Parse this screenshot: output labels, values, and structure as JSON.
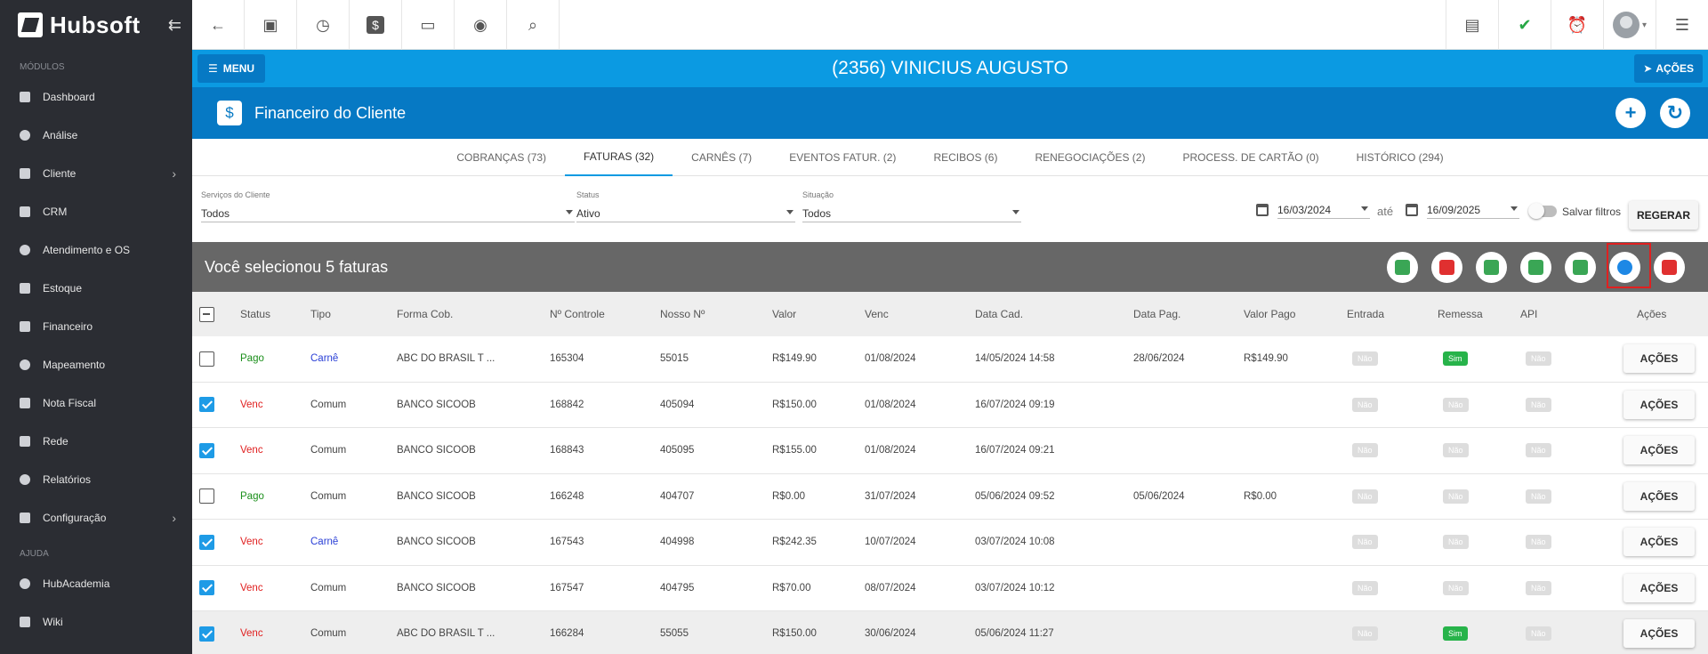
{
  "sidebar": {
    "brand": "Hubsoft",
    "collapse_icon": "arrow-collapse-icon",
    "section_modules": "MÓDULOS",
    "section_help": "AJUDA",
    "items": [
      {
        "label": "Dashboard",
        "icon": "grid-icon",
        "chevron": ""
      },
      {
        "label": "Análise",
        "icon": "pie-chart-icon",
        "chevron": ""
      },
      {
        "label": "Cliente",
        "icon": "contact-card-icon",
        "chevron": "›"
      },
      {
        "label": "CRM",
        "icon": "crm-icon",
        "chevron": ""
      },
      {
        "label": "Atendimento e OS",
        "icon": "calendar-clock-icon",
        "chevron": ""
      },
      {
        "label": "Estoque",
        "icon": "box-icon",
        "chevron": ""
      },
      {
        "label": "Financeiro",
        "icon": "money-icon",
        "chevron": ""
      },
      {
        "label": "Mapeamento",
        "icon": "map-pin-icon",
        "chevron": ""
      },
      {
        "label": "Nota Fiscal",
        "icon": "receipt-icon",
        "chevron": ""
      },
      {
        "label": "Rede",
        "icon": "network-icon",
        "chevron": ""
      },
      {
        "label": "Relatórios",
        "icon": "report-icon",
        "chevron": ""
      },
      {
        "label": "Configuração",
        "icon": "gear-icon",
        "chevron": "›"
      }
    ],
    "help_items": [
      {
        "label": "HubAcademia",
        "icon": "play-icon"
      },
      {
        "label": "Wiki",
        "icon": "wiki-icon"
      }
    ]
  },
  "topbar": {
    "left_icons": [
      "back-arrow-icon",
      "contact-icon",
      "calendar-clock-icon",
      "dollar-icon",
      "terminal-icon",
      "eye-icon",
      "search-icon"
    ],
    "right_icons": [
      "pdf-icon",
      "chat-check-icon",
      "alarm-bell-icon",
      "user-avatar-icon",
      "list-menu-icon"
    ]
  },
  "clientbar": {
    "menu_label": "MENU",
    "client_name": "(2356) VINICIUS AUGUSTO",
    "actions_label": "AÇÕES"
  },
  "section": {
    "title": "Financeiro do Cliente",
    "icon_glyph": "$"
  },
  "tabs": [
    {
      "label": "COBRANÇAS (73)",
      "active": false
    },
    {
      "label": "FATURAS (32)",
      "active": true
    },
    {
      "label": "CARNÊS (7)",
      "active": false
    },
    {
      "label": "EVENTOS FATUR. (2)",
      "active": false
    },
    {
      "label": "RECIBOS (6)",
      "active": false
    },
    {
      "label": "RENEGOCIAÇÕES (2)",
      "active": false
    },
    {
      "label": "PROCESS. DE CARTÃO (0)",
      "active": false
    },
    {
      "label": "HISTÓRICO (294)",
      "active": false
    }
  ],
  "filters": {
    "servicos_label": "Serviços do Cliente",
    "servicos_value": "Todos",
    "status_label": "Status",
    "status_value": "Ativo",
    "situacao_label": "Situação",
    "situacao_value": "Todos",
    "date_from": "16/03/2024",
    "ate": "até",
    "date_to": "16/09/2025",
    "salvar_label": "Salvar filtros",
    "regerar_label": "REGERAR"
  },
  "selection": {
    "text": "Você selecionou 5 faturas",
    "actions": [
      {
        "name": "generate-doc-icon",
        "color": "#3aa655"
      },
      {
        "name": "pdf-doc-icon",
        "color": "#e03030"
      },
      {
        "name": "print-icon",
        "color": "#3aa655"
      },
      {
        "name": "email-icon",
        "color": "#3aa655"
      },
      {
        "name": "message-icon",
        "color": "#3aa655"
      },
      {
        "name": "payment-dollar-icon",
        "color": "#1e88e5"
      },
      {
        "name": "trash-icon",
        "color": "#e03030"
      }
    ]
  },
  "table": {
    "headers": [
      "Status",
      "Tipo",
      "Forma Cob.",
      "Nº Controle",
      "Nosso Nº",
      "Valor",
      "Venc",
      "Data Cad.",
      "Data Pag.",
      "Valor Pago",
      "Entrada",
      "Remessa",
      "API",
      "Ações"
    ],
    "rows": [
      {
        "checked": false,
        "status": "Pago",
        "tipo": "Carnê",
        "forma": "ABC DO BRASIL T ...",
        "controle": "165304",
        "nosso": "55015",
        "valor": "R$149.90",
        "venc": "01/08/2024",
        "data_cad": "14/05/2024 14:58",
        "data_pag": "28/06/2024",
        "valor_pago": "R$149.90",
        "entrada": "Não",
        "remessa": "Sim",
        "api": "Não",
        "acoes": "AÇÕES"
      },
      {
        "checked": true,
        "status": "Venc",
        "tipo": "Comum",
        "forma": "BANCO SICOOB",
        "controle": "168842",
        "nosso": "405094",
        "valor": "R$150.00",
        "venc": "01/08/2024",
        "data_cad": "16/07/2024 09:19",
        "data_pag": "",
        "valor_pago": "",
        "entrada": "Não",
        "remessa": "Não",
        "api": "Não",
        "acoes": "AÇÕES"
      },
      {
        "checked": true,
        "status": "Venc",
        "tipo": "Comum",
        "forma": "BANCO SICOOB",
        "controle": "168843",
        "nosso": "405095",
        "valor": "R$155.00",
        "venc": "01/08/2024",
        "data_cad": "16/07/2024 09:21",
        "data_pag": "",
        "valor_pago": "",
        "entrada": "Não",
        "remessa": "Não",
        "api": "Não",
        "acoes": "AÇÕES"
      },
      {
        "checked": false,
        "status": "Pago",
        "tipo": "Comum",
        "forma": "BANCO SICOOB",
        "controle": "166248",
        "nosso": "404707",
        "valor": "R$0.00",
        "venc": "31/07/2024",
        "data_cad": "05/06/2024 09:52",
        "data_pag": "05/06/2024",
        "valor_pago": "R$0.00",
        "entrada": "Não",
        "remessa": "Não",
        "api": "Não",
        "acoes": "AÇÕES"
      },
      {
        "checked": true,
        "status": "Venc",
        "tipo": "Carnê",
        "forma": "BANCO SICOOB",
        "controle": "167543",
        "nosso": "404998",
        "valor": "R$242.35",
        "venc": "10/07/2024",
        "data_cad": "03/07/2024 10:08",
        "data_pag": "",
        "valor_pago": "",
        "entrada": "Não",
        "remessa": "Não",
        "api": "Não",
        "acoes": "AÇÕES"
      },
      {
        "checked": true,
        "status": "Venc",
        "tipo": "Comum",
        "forma": "BANCO SICOOB",
        "controle": "167547",
        "nosso": "404795",
        "valor": "R$70.00",
        "venc": "08/07/2024",
        "data_cad": "03/07/2024 10:12",
        "data_pag": "",
        "valor_pago": "",
        "entrada": "Não",
        "remessa": "Não",
        "api": "Não",
        "acoes": "AÇÕES"
      },
      {
        "checked": true,
        "status": "Venc",
        "tipo": "Comum",
        "forma": "ABC DO BRASIL T ...",
        "controle": "166284",
        "nosso": "55055",
        "valor": "R$150.00",
        "venc": "30/06/2024",
        "data_cad": "05/06/2024 11:27",
        "data_pag": "",
        "valor_pago": "",
        "entrada": "Não",
        "remessa": "Sim",
        "api": "Não",
        "acoes": "AÇÕES"
      }
    ]
  }
}
